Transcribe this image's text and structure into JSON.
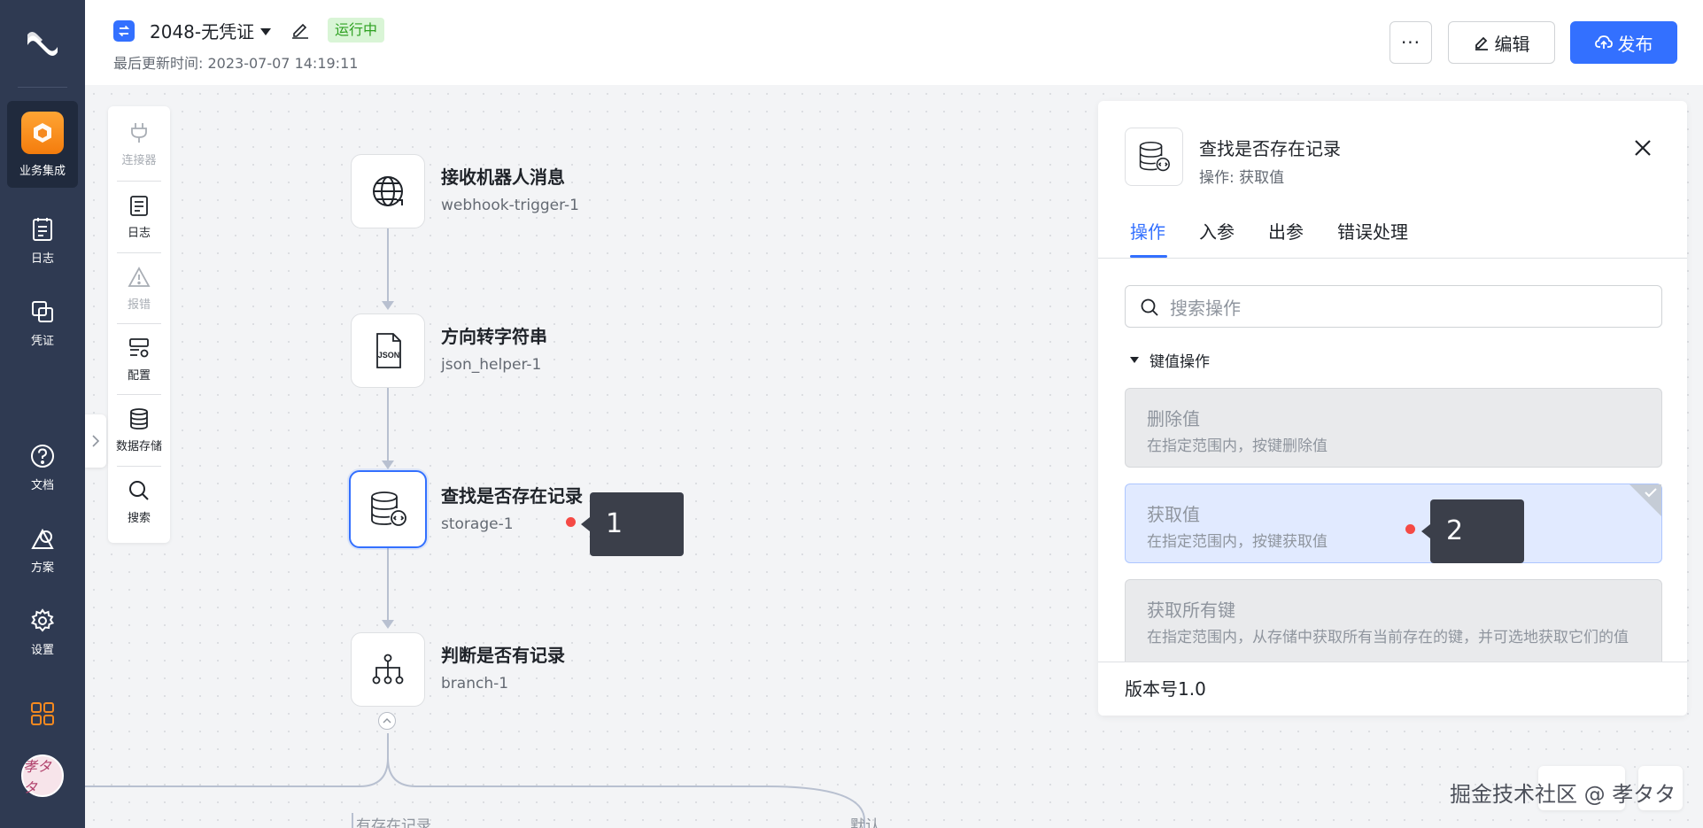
{
  "nav": {
    "items": [
      {
        "label": "业务集成",
        "icon": "brand-icon"
      },
      {
        "label": "日志",
        "icon": "log-icon"
      },
      {
        "label": "凭证",
        "icon": "credential-icon"
      },
      {
        "label": "文档",
        "icon": "help-icon"
      },
      {
        "label": "方案",
        "icon": "solution-icon"
      },
      {
        "label": "设置",
        "icon": "gear-icon"
      }
    ],
    "avatar_text": "孝タタ"
  },
  "header": {
    "flow_name": "2048-无凭证",
    "status_badge": "运行中",
    "update_label": "最后更新时间:",
    "update_time": "2023-07-07 14:19:11",
    "more_label": "···",
    "edit_label": "编辑",
    "publish_label": "发布"
  },
  "toolbox": {
    "items": [
      {
        "label": "连接器",
        "icon": "plug-icon",
        "enabled": false
      },
      {
        "label": "日志",
        "icon": "log-icon",
        "enabled": true
      },
      {
        "label": "报错",
        "icon": "warning-icon",
        "enabled": false
      },
      {
        "label": "配置",
        "icon": "config-icon",
        "enabled": true
      },
      {
        "label": "数据存储",
        "icon": "database-icon",
        "enabled": true
      },
      {
        "label": "搜索",
        "icon": "search-icon",
        "enabled": true
      }
    ]
  },
  "flow": {
    "nodes": [
      {
        "title": "接收机器人消息",
        "id": "webhook-trigger-1",
        "icon": "globe-icon"
      },
      {
        "title": "方向转字符串",
        "id": "json_helper-1",
        "icon": "json-file-icon"
      },
      {
        "title": "查找是否存在记录",
        "id": "storage-1",
        "icon": "database-icon",
        "selected": true
      },
      {
        "title": "判断是否有记录",
        "id": "branch-1",
        "icon": "branch-icon"
      }
    ],
    "branch_labels": [
      "有存在记录",
      "默认"
    ]
  },
  "markers": [
    "1",
    "2"
  ],
  "panel": {
    "title": "查找是否存在记录",
    "operation": "操作: 获取值",
    "tabs": [
      "操作",
      "入参",
      "出参",
      "错误处理"
    ],
    "active_tab": "操作",
    "search_placeholder": "搜索操作",
    "group_title": "键值操作",
    "operations": [
      {
        "name": "删除值",
        "desc": "在指定范围内，按键删除值"
      },
      {
        "name": "获取值",
        "desc": "在指定范围内，按键获取值",
        "selected": true
      },
      {
        "name": "获取所有键",
        "desc": "在指定范围内，从存储中获取所有当前存在的键，并可选地获取它们的值"
      }
    ],
    "version": "版本号1.0"
  },
  "watermark": "掘金技术社区 @ 孝タタ",
  "colors": {
    "nav_bg": "#2f3a52",
    "accent": "#3370ff",
    "brand_orange": "#f5891f",
    "status_green": "#2ea121",
    "marker_bg": "#3b3f4a",
    "marker_dot": "#f54a45"
  }
}
